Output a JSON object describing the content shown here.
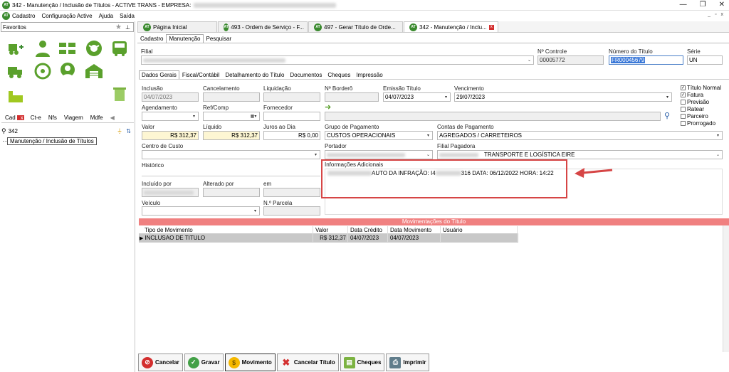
{
  "window": {
    "title": "342 - Manutenção / Inclusão de Títulos - ACTIVE TRANS - EMPRESA:",
    "controls": [
      "minimize",
      "restore",
      "close"
    ]
  },
  "menu": {
    "items": [
      "Cadastro",
      "Configuração Active",
      "Ajuda",
      "Saída"
    ],
    "mdi_controls": [
      "_",
      "▫",
      "x"
    ]
  },
  "left": {
    "favorites_label": "Favoritos",
    "tabs": [
      "Cad",
      "Ct-e",
      "Nfs",
      "Viagem",
      "Mdfe"
    ],
    "search_value": "342",
    "tree_item": "Manutenção / Inclusão de Títulos"
  },
  "doc_tabs": [
    {
      "label": "Página Inicial"
    },
    {
      "label": "493 - Ordem de Serviço - F..."
    },
    {
      "label": "497 - Gerar Título de Orde..."
    },
    {
      "label": "342 - Manutenção / Inclu..."
    }
  ],
  "sub_tabs": [
    "Cadastro",
    "Manutenção",
    "Pesquisar"
  ],
  "header": {
    "filial_label": "Filial",
    "controle_label": "Nº Controle",
    "controle_value": "00005772",
    "numero_label": "Número do Título",
    "numero_value": "FR00045679",
    "serie_label": "Série",
    "serie_value": "UN"
  },
  "inner_tabs": [
    "Dados Gerais",
    "Fiscal/Contábil",
    "Detalhamento do Título",
    "Documentos",
    "Cheques",
    "Impressão"
  ],
  "form": {
    "inclusao_label": "Inclusão",
    "inclusao_value": "04/07/2023",
    "cancelamento_label": "Cancelamento",
    "liquidacao_label": "Liquidação",
    "bordero_label": "Nº Borderô",
    "emissao_label": "Emissão Título",
    "emissao_value": "04/07/2023",
    "vencimento_label": "Vencimento",
    "vencimento_value": "29/07/2023",
    "agendamento_label": "Agendamento",
    "refcomp_label": "Ref/Comp",
    "fornecedor_label": "Fornecedor",
    "valor_label": "Valor",
    "valor_value": "R$ 312,37",
    "liquido_label": "Líquido",
    "liquido_value": "R$ 312,37",
    "juros_label": "Juros ao Dia",
    "juros_value": "R$ 0,00",
    "grupo_label": "Grupo de Pagamento",
    "grupo_value": "CUSTOS OPERACIONAIS",
    "contas_label": "Contas de Pagamento",
    "contas_value": "AGREGADOS / CARRETEIROS",
    "centro_label": "Centro de Custo",
    "portador_label": "Portador",
    "filial_pag_label": "Filial Pagadora",
    "filial_pag_value": "TRANSPORTE E LOGÍSTICA EIRE",
    "historico_label": "Histórico",
    "info_label": "Informações Adicionais",
    "info_value_a": "AUTO DA INFRAÇÃO: I4",
    "info_value_b": "316 DATA: 06/12/2022 HORA: 14:22",
    "incluido_label": "Incluído por",
    "alterado_label": "Alterado por",
    "em_label": "em",
    "veiculo_label": "Veículo",
    "parcela_label": "N.º Parcela"
  },
  "checks": [
    {
      "label": "Título Normal",
      "checked": true
    },
    {
      "label": "Fatura",
      "checked": true
    },
    {
      "label": "Previsão",
      "checked": false
    },
    {
      "label": "Ratear",
      "checked": false
    },
    {
      "label": "Parceiro",
      "checked": false
    },
    {
      "label": "Prorrogado",
      "checked": false
    }
  ],
  "movimentos": {
    "title": "Movimentações do Título",
    "columns": [
      "Tipo de Movimento",
      "Valor",
      "Data Crédito",
      "Data Movimento",
      "Usuário"
    ],
    "rows": [
      [
        "INCLUSAO DE TITULO",
        "R$ 312,37",
        "04/07/2023",
        "04/07/2023",
        ""
      ]
    ]
  },
  "buttons": [
    {
      "label": "Cancelar",
      "icon": "cancel-icon",
      "color": "#d32f2f",
      "glyph": "⊘"
    },
    {
      "label": "Gravar",
      "icon": "check-icon",
      "color": "#43a047",
      "glyph": "✓"
    },
    {
      "label": "Movimento",
      "icon": "coin-icon",
      "color": "#f5b800",
      "glyph": "$"
    },
    {
      "label": "Cancelar Título",
      "icon": "x-icon",
      "color": "#ffffff",
      "glyph": "✖"
    },
    {
      "label": "Cheques",
      "icon": "cheque-icon",
      "color": "#7cb342",
      "glyph": "▤"
    },
    {
      "label": "Imprimir",
      "icon": "printer-icon",
      "color": "#607d8b",
      "glyph": "⎙"
    }
  ]
}
